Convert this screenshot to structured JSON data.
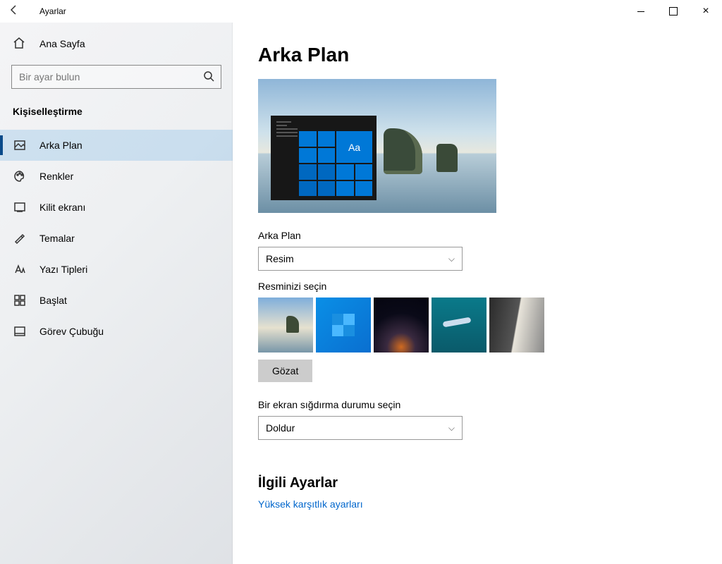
{
  "window": {
    "title": "Ayarlar"
  },
  "sidebar": {
    "home": "Ana Sayfa",
    "search_placeholder": "Bir ayar bulun",
    "section": "Kişiselleştirme",
    "items": [
      {
        "label": "Arka Plan"
      },
      {
        "label": "Renkler"
      },
      {
        "label": "Kilit ekranı"
      },
      {
        "label": "Temalar"
      },
      {
        "label": "Yazı Tipleri"
      },
      {
        "label": "Başlat"
      },
      {
        "label": "Görev Çubuğu"
      }
    ]
  },
  "main": {
    "heading": "Arka Plan",
    "preview_sample_text": "Aa",
    "bg_label": "Arka Plan",
    "bg_value": "Resim",
    "choose_label": "Resminizi seçin",
    "browse": "Gözat",
    "fit_label": "Bir ekran sığdırma durumu seçin",
    "fit_value": "Doldur",
    "related_heading": "İlgili Ayarlar",
    "related_link": "Yüksek karşıtlık ayarları"
  }
}
